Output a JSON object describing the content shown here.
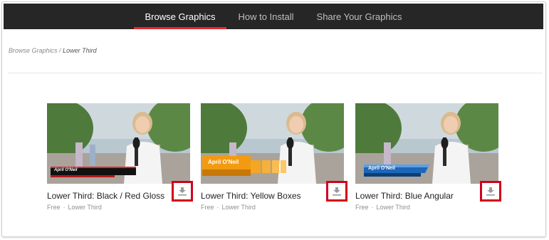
{
  "nav": {
    "tabs": [
      {
        "label": "Browse Graphics",
        "active": true
      },
      {
        "label": "How to Install",
        "active": false
      },
      {
        "label": "Share Your Graphics",
        "active": false
      }
    ]
  },
  "breadcrumb": {
    "parent": "Browse Graphics",
    "separator": "/",
    "current": "Lower Third"
  },
  "cards": [
    {
      "title": "Lower Third: Black / Red Gloss",
      "price": "Free",
      "category": "Lower Third",
      "overlay_name": "April O'Neil",
      "style": "black-red-gloss",
      "icon": "download-icon"
    },
    {
      "title": "Lower Third: Yellow Boxes",
      "price": "Free",
      "category": "Lower Third",
      "overlay_name": "April O'Neil",
      "style": "yellow-boxes",
      "icon": "download-icon"
    },
    {
      "title": "Lower Third: Blue Angular",
      "price": "Free",
      "category": "Lower Third",
      "overlay_name": "April O'Neil",
      "style": "blue-angular",
      "icon": "download-icon"
    }
  ],
  "colors": {
    "nav_bg": "#262626",
    "accent_red": "#e8262d",
    "highlight_box": "#d0021b"
  }
}
